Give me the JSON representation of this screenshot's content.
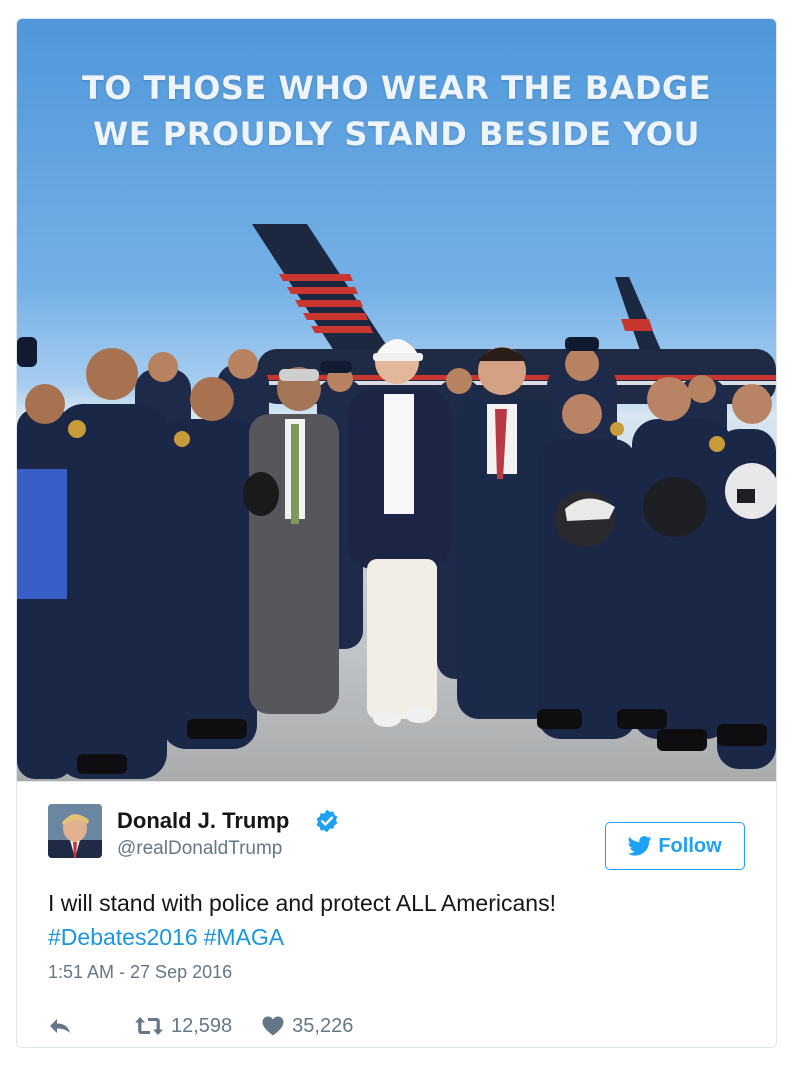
{
  "photo": {
    "headline_line1": "TO THOSE WHO WEAR THE BADGE",
    "headline_line2": "WE PROUDLY STAND BESIDE YOU"
  },
  "tweet": {
    "author_name": "Donald J. Trump",
    "author_handle": "@realDonaldTrump",
    "verified_icon": "verified-badge-icon",
    "follow_label": "Follow",
    "text": "I will stand with police and protect ALL Americans!",
    "hashtags": [
      "#Debates2016",
      "#MAGA"
    ],
    "timestamp": "1:51 AM - 27 Sep 2016",
    "retweet_count": "12,598",
    "like_count": "35,226"
  },
  "icons": {
    "reply": "reply-icon",
    "retweet": "retweet-icon",
    "like": "heart-icon",
    "follow": "twitter-bird-icon"
  },
  "colors": {
    "accent": "#1da1f2",
    "link": "#1b95e0",
    "muted": "#657786",
    "sky_top": "#4f97da"
  }
}
